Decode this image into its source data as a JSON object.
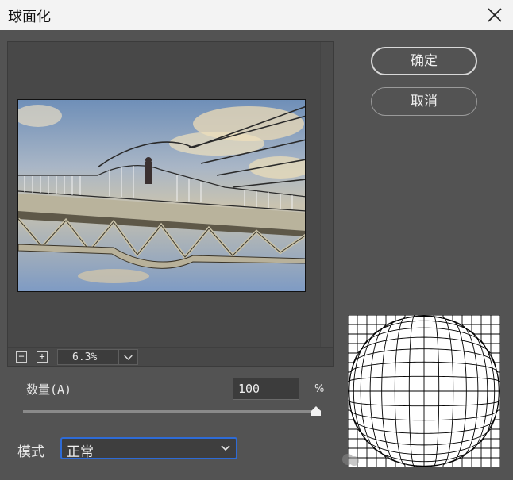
{
  "window": {
    "title": "球面化"
  },
  "buttons": {
    "ok_label": "确定",
    "cancel_label": "取消"
  },
  "preview": {
    "zoom_out_symbol": "−",
    "zoom_in_symbol": "+",
    "zoom_value": "6.3%"
  },
  "amount": {
    "label": "数量(A)",
    "value": "100",
    "unit": "%",
    "slider_fraction": 1.0
  },
  "mode": {
    "label": "模式",
    "selected": "正常"
  },
  "colors": {
    "dialog_bg": "#535353",
    "titlebar_bg": "#f3f3f3",
    "focus_accent": "#2e6bd6"
  },
  "icons": {
    "close": "close-icon",
    "zoom_out": "zoom-out-icon",
    "zoom_in": "zoom-in-icon",
    "dropdown": "chevron-down-icon",
    "watermark": "wechat-icon"
  }
}
